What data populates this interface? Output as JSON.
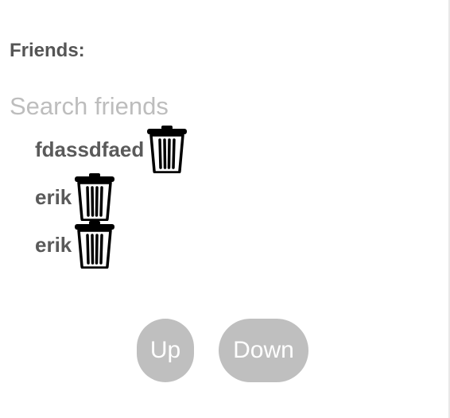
{
  "friends_panel": {
    "heading": "Friends:",
    "search": {
      "placeholder": "Search friends",
      "value": ""
    },
    "friends": [
      {
        "name": "fdassdfaed",
        "delete_icon": "trash-can-icon"
      },
      {
        "name": "erik",
        "delete_icon": "trash-can-icon"
      },
      {
        "name": "erik",
        "delete_icon": "trash-can-icon"
      }
    ],
    "buttons": {
      "up_label": "Up",
      "down_label": "Down"
    },
    "colors": {
      "heading_text": "#555555",
      "placeholder_text": "#bdbdbd",
      "button_bg": "#bfbfbf",
      "button_text": "#ffffff"
    }
  }
}
